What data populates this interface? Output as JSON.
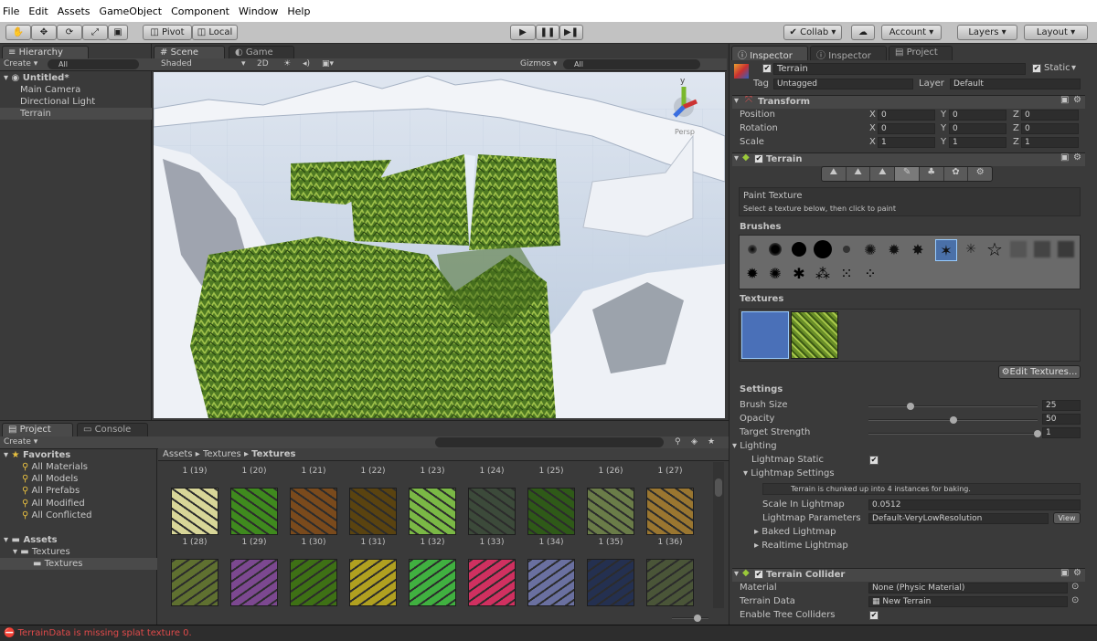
{
  "menu": [
    "File",
    "Edit",
    "Assets",
    "GameObject",
    "Component",
    "Window",
    "Help"
  ],
  "toolbar": {
    "pivot": "Pivot",
    "local": "Local",
    "collab": "Collab",
    "account": "Account",
    "layers": "Layers",
    "layout": "Layout"
  },
  "hierarchy": {
    "tab": "Hierarchy",
    "create": "Create",
    "search": "All",
    "scene": "Untitled*",
    "items": [
      "Main Camera",
      "Directional Light",
      "Terrain"
    ]
  },
  "scene": {
    "tab": "Scene",
    "game_tab": "Game",
    "shaded": "Shaded",
    "mode2d": "2D",
    "gizmos": "Gizmos",
    "search": "All",
    "persp": "Persp"
  },
  "inspector": {
    "tabs": [
      "Inspector",
      "Inspector",
      "Project"
    ],
    "object_name": "Terrain",
    "static": "Static",
    "tag_label": "Tag",
    "tag": "Untagged",
    "layer_label": "Layer",
    "layer": "Default",
    "transform": {
      "title": "Transform",
      "rows": [
        {
          "label": "Position",
          "x": "0",
          "y": "0",
          "z": "0"
        },
        {
          "label": "Rotation",
          "x": "0",
          "y": "0",
          "z": "0"
        },
        {
          "label": "Scale",
          "x": "1",
          "y": "1",
          "z": "1"
        }
      ]
    },
    "terrain": {
      "title": "Terrain",
      "paint_title": "Paint Texture",
      "paint_hint": "Select a texture below, then click to paint",
      "brushes": "Brushes",
      "textures": "Textures",
      "edit_textures": "Edit Textures...",
      "settings": "Settings",
      "brush_size_label": "Brush Size",
      "brush_size": "25",
      "brush_size_level": 0.25,
      "opacity_label": "Opacity",
      "opacity": "50",
      "opacity_level": 0.5,
      "strength_label": "Target Strength",
      "strength": "1",
      "strength_level": 1.0,
      "lighting": "Lighting",
      "lm_static": "Lightmap Static",
      "lm_settings": "Lightmap Settings",
      "chunk_note": "Terrain is chunked up into 4 instances for baking.",
      "scale_lm_label": "Scale In Lightmap",
      "scale_lm": "0.0512",
      "lm_params_label": "Lightmap Parameters",
      "lm_params": "Default-VeryLowResolution",
      "view": "View",
      "baked": "Baked Lightmap",
      "realtime": "Realtime Lightmap"
    },
    "collider": {
      "title": "Terrain Collider",
      "material_label": "Material",
      "material": "None (Physic Material)",
      "data_label": "Terrain Data",
      "data": "New Terrain",
      "trees_label": "Enable Tree Colliders"
    },
    "xyz": [
      "X",
      "Y",
      "Z"
    ]
  },
  "project": {
    "tab": "Project",
    "console_tab": "Console",
    "create": "Create",
    "favorites": "Favorites",
    "fav_items": [
      "All Materials",
      "All Models",
      "All Prefabs",
      "All Modified",
      "All Conflicted"
    ],
    "assets": "Assets",
    "folder1": "Textures",
    "folder2": "Textures",
    "breadcrumb": [
      "Assets",
      "Textures",
      "Textures"
    ],
    "row0": [
      "1 (19)",
      "1 (20)",
      "1 (21)",
      "1 (22)",
      "1 (23)",
      "1 (24)",
      "1 (25)",
      "1 (26)",
      "1 (27)"
    ],
    "row1": [
      "1 (28)",
      "1 (29)",
      "1 (30)",
      "1 (31)",
      "1 (32)",
      "1 (33)",
      "1 (34)",
      "1 (35)",
      "1 (36)"
    ],
    "row1_colors": [
      "#d8d698",
      "#3f8a1e",
      "#7a4a1c",
      "#5a4310",
      "#7ab845",
      "#3c4a3a",
      "#2f5a18",
      "#6a7c48",
      "#9a7630"
    ],
    "row2_colors": [
      "#5f7030",
      "#7c4890",
      "#3e7015",
      "#b0a020",
      "#40b040",
      "#d03060",
      "#6a70a0",
      "#243050",
      "#4a5538"
    ]
  },
  "status": {
    "error": "TerrainData is missing splat texture 0."
  }
}
